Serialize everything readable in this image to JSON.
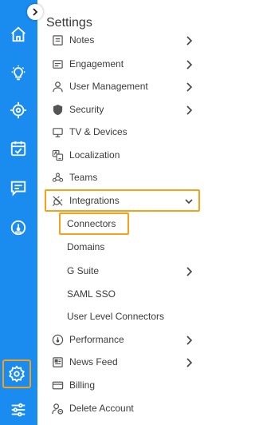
{
  "settings_title": "Settings",
  "menu": {
    "notes": "Notes",
    "engagement": "Engagement",
    "user_management": "User Management",
    "security": "Security",
    "tv_devices": "TV & Devices",
    "localization": "Localization",
    "teams": "Teams",
    "integrations": "Integrations",
    "connectors": "Connectors",
    "domains": "Domains",
    "g_suite": "G Suite",
    "saml_sso": "SAML SSO",
    "user_level_connectors": "User Level Connectors",
    "performance": "Performance",
    "news_feed": "News Feed",
    "billing": "Billing",
    "delete_account": "Delete Account"
  },
  "colors": {
    "rail": "#1a8cf0",
    "highlight": "#f7a11a",
    "text": "#3b3b3b"
  },
  "icons": {
    "rail": [
      "home-icon",
      "bulb-icon",
      "target-icon",
      "calendar-check-icon",
      "chat-icon",
      "gauge-icon",
      "gear-icon",
      "sliders-icon"
    ]
  }
}
